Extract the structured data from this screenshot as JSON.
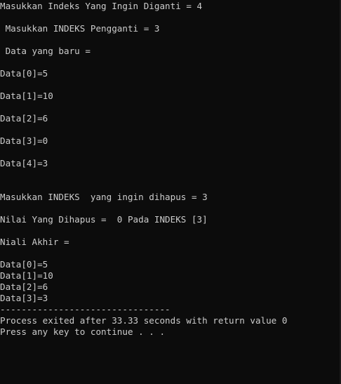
{
  "console": {
    "lines": [
      "Masukkan Indeks Yang Ingin Diganti = 4",
      "",
      " Masukkan INDEKS Pengganti = 3",
      "",
      " Data yang baru =",
      "",
      "Data[0]=5",
      "",
      "Data[1]=10",
      "",
      "Data[2]=6",
      "",
      "Data[3]=0",
      "",
      "Data[4]=3",
      "",
      "",
      "Masukkan INDEKS  yang ingin dihapus = 3",
      "",
      "Nilai Yang Dihapus =  0 Pada INDEKS [3]",
      "",
      "Niali Akhir =",
      "",
      "Data[0]=5",
      "Data[1]=10",
      "Data[2]=6",
      "Data[3]=3",
      "--------------------------------",
      "Process exited after 33.33 seconds with return value 0",
      "Press any key to continue . . ."
    ]
  },
  "colors": {
    "background": "#0c0c0c",
    "text": "#cccccc"
  }
}
